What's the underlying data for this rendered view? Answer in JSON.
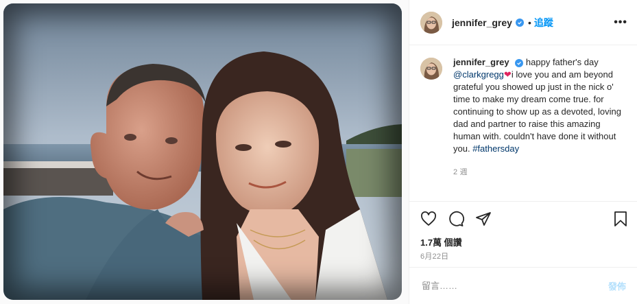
{
  "post": {
    "photo_alt": "",
    "user": {
      "username": "jennifer_grey",
      "verified": true
    },
    "header": {
      "separator": "•",
      "follow_label": "追蹤",
      "more_label": "•••"
    },
    "caption": {
      "text_1": "happy father's day ",
      "mention": "@clarkgregg",
      "heart": "❤",
      "text_2": "i love you and am beyond grateful you showed up just in the nick o' time to make my dream come true. for continuing to show up as a devoted, loving dad and partner to raise this amazing human with. couldn't have done it without you. ",
      "hashtag": "#fathersday",
      "time_ago": "2 週"
    },
    "actions": {
      "like_icon": "heart-outline-icon",
      "comment_icon": "comment-bubble-icon",
      "share_icon": "paper-plane-icon",
      "save_icon": "bookmark-icon"
    },
    "likes": "1.7萬 個讚",
    "date": "6月22日",
    "comment_box": {
      "placeholder": "留言……",
      "post_label": "發佈"
    },
    "colors": {
      "link": "#00376b",
      "follow": "#0095f6",
      "post_disabled": "#b2dffc",
      "verified": "#3897f0",
      "heart": "#e0245e"
    }
  }
}
